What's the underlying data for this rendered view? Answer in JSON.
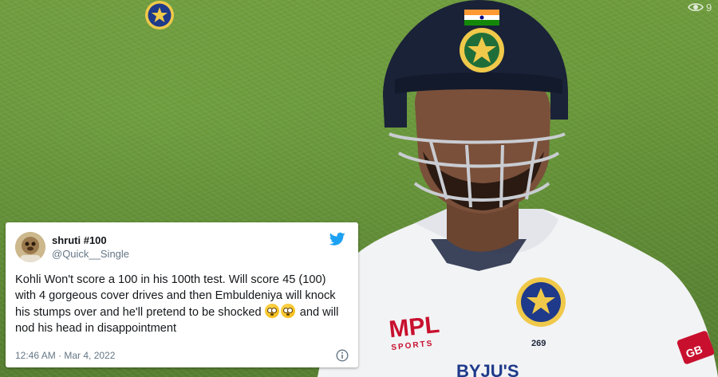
{
  "tweet": {
    "display_name": "shruti #100",
    "handle": "@Quick__Single",
    "text_before_emoji": "Kohli Won't score a 100 in his 100th test. Will score 45 (100) with 4 gorgeous cover drives and then Embuldeniya will knock his stumps over and he'll pretend to be shocked ",
    "text_after_emoji": " and will nod his head in disappointment",
    "timestamp": "12:46 AM · Mar 4, 2022"
  },
  "photo": {
    "views_count": "9",
    "jersey_sponsor_line1": "MPL",
    "jersey_sponsor_line2": "SPORTS",
    "jersey_number": "269",
    "chest_text": "BYJU'S",
    "sleeve_text": "GB"
  },
  "colors": {
    "twitter_blue": "#1da1f2",
    "helmet_navy": "#1a2238",
    "jersey_white": "#f2f3f5",
    "sponsor_red": "#c8102e"
  },
  "icons": {
    "logo": "twitter-bird-icon",
    "info": "info-circle-icon",
    "views": "eye-icon",
    "emoji": "flushed-face-emoji"
  }
}
